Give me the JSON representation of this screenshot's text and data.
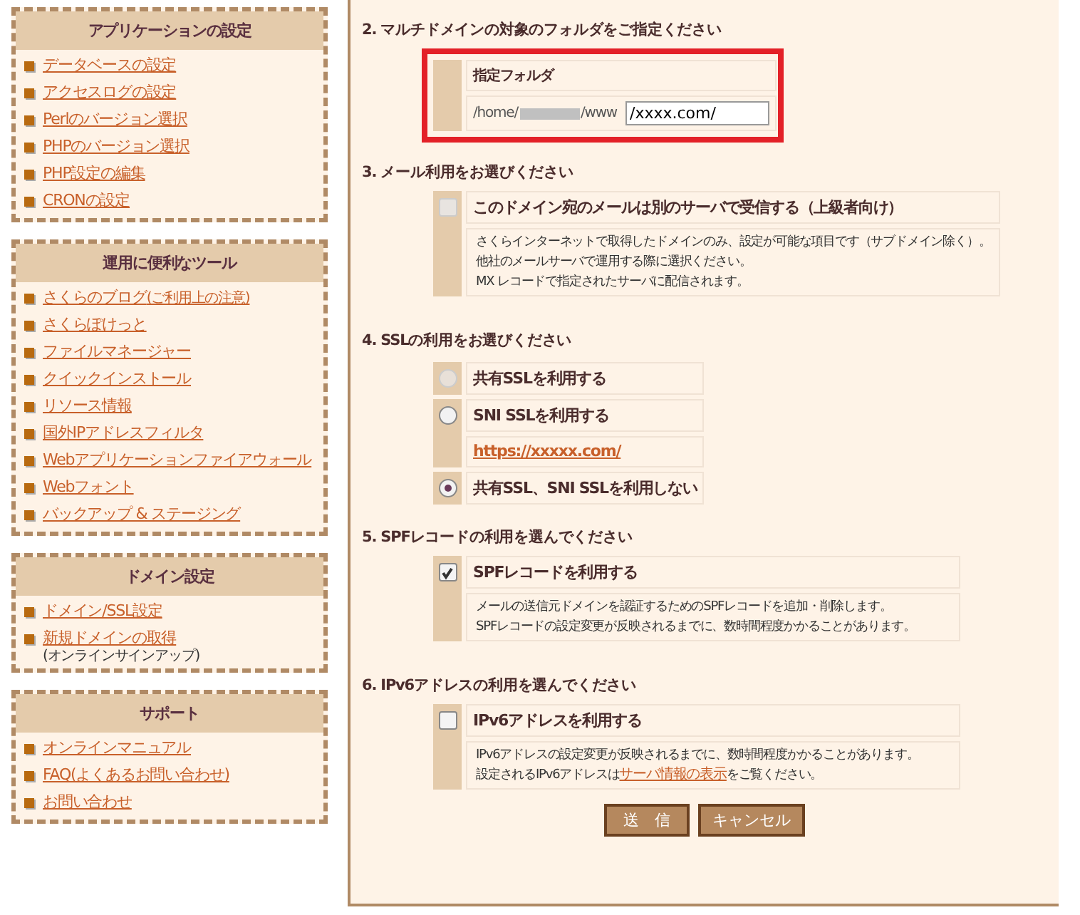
{
  "sidebar": [
    {
      "title": "アプリケーションの設定",
      "items": [
        {
          "label": "データベースの設定"
        },
        {
          "label": "アクセスログの設定"
        },
        {
          "label": "Perlのバージョン選択"
        },
        {
          "label": "PHPのバージョン選択"
        },
        {
          "label": "PHP設定の編集"
        },
        {
          "label": "CRONの設定"
        }
      ]
    },
    {
      "title": "運用に便利なツール",
      "items": [
        {
          "label": "さくらのブログ",
          "extra_link": "(ご利用上の注意)"
        },
        {
          "label": "さくらぽけっと"
        },
        {
          "label": "ファイルマネージャー"
        },
        {
          "label": "クイックインストール"
        },
        {
          "label": "リソース情報"
        },
        {
          "label": "国外IPアドレスフィルタ"
        },
        {
          "label": "Webアプリケーションファイアウォール"
        },
        {
          "label": "Webフォント"
        },
        {
          "label": "バックアップ & ステージング"
        }
      ]
    },
    {
      "title": "ドメイン設定",
      "items": [
        {
          "label": "ドメイン/SSL設定"
        },
        {
          "label": "新規ドメインの取得",
          "note": "(オンラインサインアップ)"
        }
      ]
    },
    {
      "title": "サポート",
      "items": [
        {
          "label": "オンラインマニュアル"
        },
        {
          "label": "FAQ(よくあるお問い合わせ)"
        },
        {
          "label": "お問い合わせ"
        }
      ]
    }
  ],
  "sections": [
    {
      "kind": "folder",
      "heading": "2. マルチドメインの対象のフォルダをご指定ください",
      "highlighted": true,
      "label": "指定フォルダ",
      "path_prefix": "/home/",
      "path_suffix": "/www",
      "value": "/xxxx.com/"
    },
    {
      "kind": "checkbox",
      "heading": "3. メール利用をお選びください",
      "label": "このドメイン宛のメールは別のサーバで受信する（上級者向け）",
      "checked": false,
      "disabled": true,
      "lines": [
        "さくらインターネットで取得したドメインのみ、設定が可能な項目です（サブドメイン除く）。",
        "他社のメールサーバで運用する際に選択ください。",
        "MX レコードで指定されたサーバに配信されます。"
      ]
    },
    {
      "kind": "radio",
      "heading": "4. SSLの利用をお選びください",
      "options": [
        {
          "label": "共有SSLを利用する",
          "selected": false,
          "disabled": true
        },
        {
          "label": "SNI SSLを利用する",
          "selected": false,
          "disabled": false,
          "link": "https://xxxxx.com/"
        },
        {
          "label": "共有SSL、SNI SSLを利用しない",
          "selected": true,
          "disabled": false
        }
      ]
    },
    {
      "kind": "checkbox",
      "heading": "5. SPFレコードの利用を選んでください",
      "label": "SPFレコードを利用する",
      "checked": true,
      "disabled": false,
      "lines": [
        "メールの送信元ドメインを認証するためのSPFレコードを追加・削除します。",
        "SPFレコードの設定変更が反映されるまでに、数時間程度かかることがあります。"
      ]
    },
    {
      "kind": "checkbox",
      "heading": "6. IPv6アドレスの利用を選んでください",
      "label": "IPv6アドレスを利用する",
      "checked": false,
      "disabled": false,
      "lines": [
        "IPv6アドレスの設定変更が反映されるまでに、数時間程度かかることがあります。"
      ],
      "last_line": {
        "before": "設定されるIPv6アドレスは",
        "link": "サーバ情報の表示",
        "after": "をご覧ください。"
      }
    }
  ],
  "buttons": [
    {
      "label": "送　信"
    },
    {
      "label": "キャンセル"
    }
  ]
}
